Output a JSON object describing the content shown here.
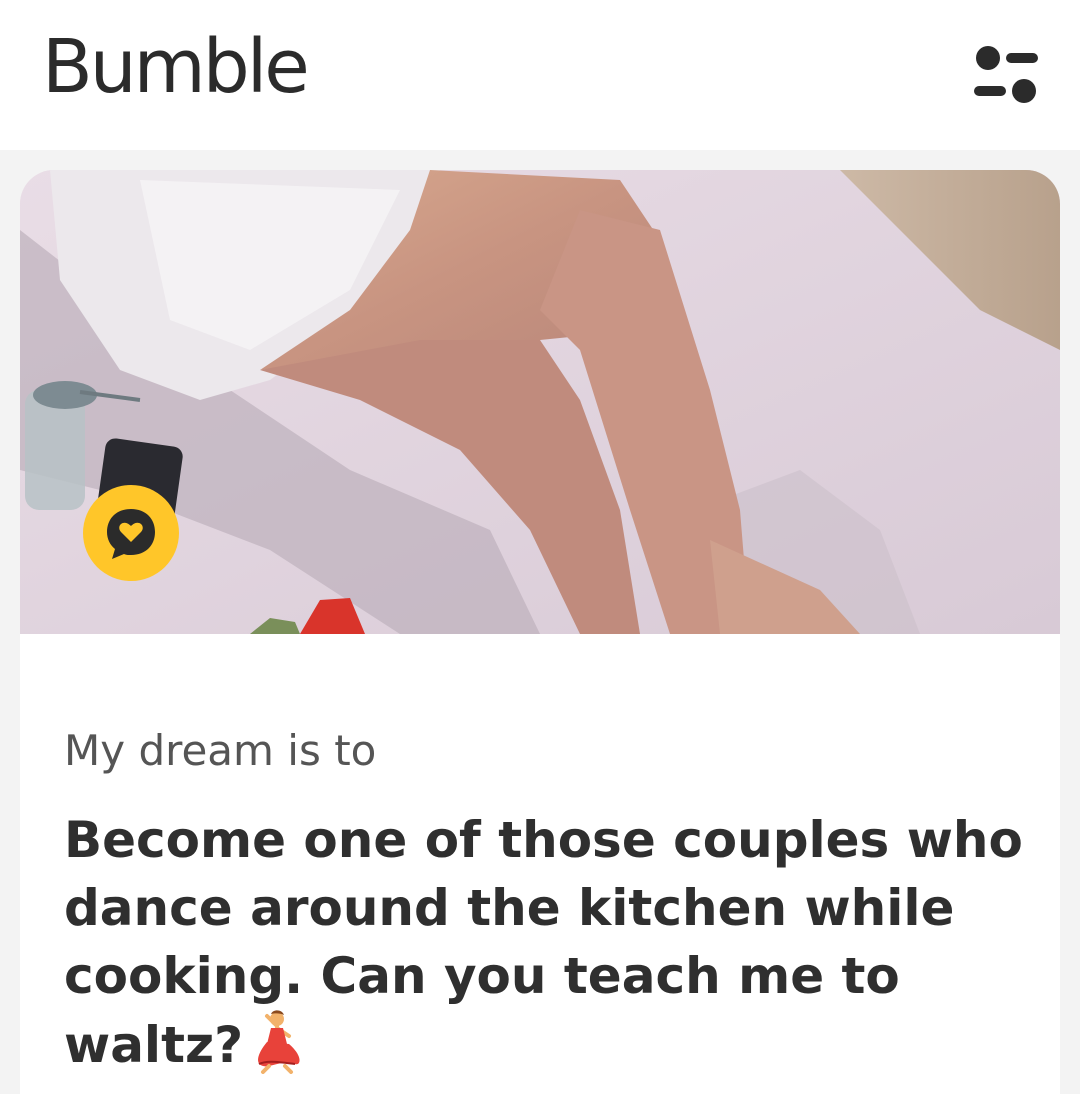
{
  "header": {
    "app_title": "Bumble",
    "filter_icon": "filter-toggles-icon"
  },
  "profile_card": {
    "photo": {
      "description_icon": "profile-photo",
      "chat_icon": "chat-heart-icon"
    },
    "prompt": {
      "label": "My dream is to",
      "answer": "Become one of those couples who dance around the kitchen while cooking. Can you teach me to waltz?",
      "emoji_icon": "dancer-emoji-icon"
    }
  },
  "colors": {
    "brand_yellow": "#ffc629",
    "text_dark": "#2f2f2f",
    "text_muted": "#555555",
    "background": "#f3f3f3"
  }
}
